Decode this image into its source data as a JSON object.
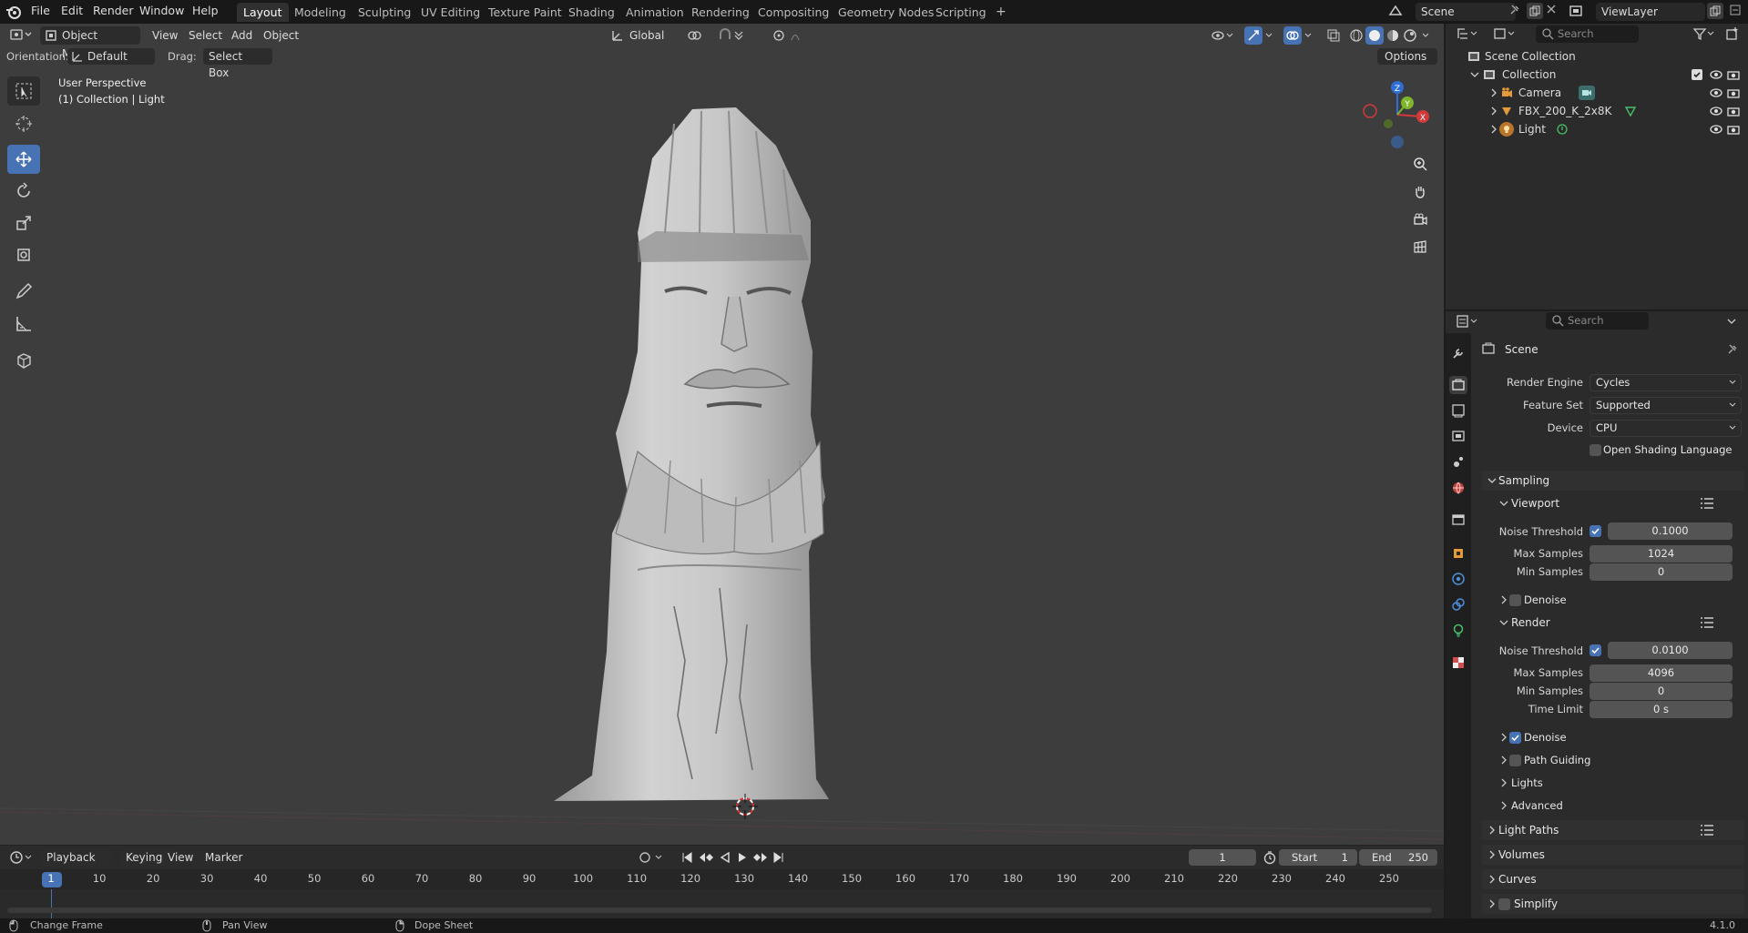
{
  "topbar": {
    "menus": [
      "File",
      "Edit",
      "Render",
      "Window",
      "Help"
    ],
    "workspaces": [
      "Layout",
      "Modeling",
      "Sculpting",
      "UV Editing",
      "Texture Paint",
      "Shading",
      "Animation",
      "Rendering",
      "Compositing",
      "Geometry Nodes",
      "Scripting"
    ],
    "active_workspace": "Layout",
    "add_tab": "+",
    "scene": "Scene",
    "view_layer": "ViewLayer"
  },
  "viewport_header": {
    "mode": "Object Mode",
    "menus": [
      "View",
      "Select",
      "Add",
      "Object"
    ],
    "transform_orientation": "Global",
    "orientation_label": "Orientation:",
    "orientation_value": "Default",
    "drag_label": "Drag:",
    "drag_value": "Select Box",
    "options": "Options"
  },
  "viewport": {
    "perspective": "User Perspective",
    "context": "(1) Collection | Light"
  },
  "gizmo": {
    "z": "Z",
    "y": "Y",
    "x": "X"
  },
  "outliner": {
    "search_placeholder": "Search",
    "root": "Scene Collection",
    "collection": "Collection",
    "items": [
      "Camera",
      "FBX_200_K_2x8K",
      "Light"
    ]
  },
  "properties": {
    "search_placeholder": "Search",
    "context": "Scene",
    "render_engine_label": "Render Engine",
    "render_engine": "Cycles",
    "feature_set_label": "Feature Set",
    "feature_set": "Supported",
    "device_label": "Device",
    "device": "CPU",
    "osl": "Open Shading Language",
    "sampling": "Sampling",
    "viewport": {
      "title": "Viewport",
      "noise_threshold_label": "Noise Threshold",
      "noise_threshold": "0.1000",
      "max_samples_label": "Max Samples",
      "max_samples": "1024",
      "min_samples_label": "Min Samples",
      "min_samples": "0",
      "denoise": "Denoise"
    },
    "render": {
      "title": "Render",
      "noise_threshold_label": "Noise Threshold",
      "noise_threshold": "0.0100",
      "max_samples_label": "Max Samples",
      "max_samples": "4096",
      "min_samples_label": "Min Samples",
      "min_samples": "0",
      "time_limit_label": "Time Limit",
      "time_limit": "0 s",
      "denoise": "Denoise",
      "path_guiding": "Path Guiding",
      "lights": "Lights",
      "advanced": "Advanced"
    },
    "light_paths": "Light Paths",
    "volumes": "Volumes",
    "curves": "Curves",
    "simplify": "Simplify"
  },
  "timeline": {
    "menus": [
      "Playback",
      "Keying",
      "View",
      "Marker"
    ],
    "current_frame": "1",
    "start_label": "Start",
    "start": "1",
    "end_label": "End",
    "end": "250",
    "ticks": [
      "1",
      "10",
      "20",
      "30",
      "40",
      "50",
      "60",
      "70",
      "80",
      "90",
      "100",
      "110",
      "120",
      "130",
      "140",
      "150",
      "160",
      "170",
      "180",
      "190",
      "200",
      "210",
      "220",
      "230",
      "240",
      "250"
    ]
  },
  "status": {
    "change_frame": "Change Frame",
    "pan_view": "Pan View",
    "dope_sheet": "Dope Sheet",
    "version": "4.1.0"
  }
}
